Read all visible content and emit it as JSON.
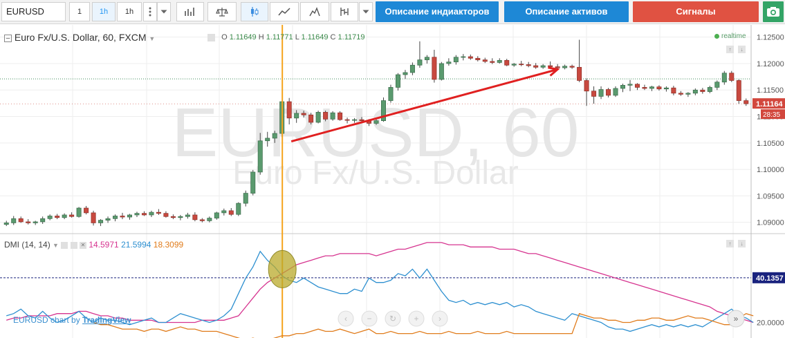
{
  "toolbar": {
    "symbol": "EURUSD",
    "intervals": [
      "1",
      "1h",
      "1h"
    ],
    "buttons": {
      "indicators": "Описание индиакторов",
      "assets": "Описание активов",
      "signals": "Сигналы"
    },
    "colors": {
      "blue": "#1e88d6",
      "red": "#e05242",
      "green": "#33a466"
    }
  },
  "chart_data": [
    {
      "type": "candlestick",
      "title": "Euro Fx/U.S. Dollar, 60, FXCM",
      "watermark_symbol": "EURUSD, 60",
      "watermark_name": "Euro Fx/U.S. Dollar",
      "ohlc_legend": {
        "o_label": "O",
        "o": "1.11649",
        "h_label": "H",
        "h": "1.11771",
        "l_label": "L",
        "l": "1.11649",
        "c_label": "C",
        "c": "1.11719"
      },
      "realtime_label": "realtime",
      "ylim": [
        1.088,
        1.126
      ],
      "y_ticks": [
        "1.12500",
        "1.12000",
        "1.11500",
        "1.11000",
        "1.10500",
        "1.10000",
        "1.09500",
        "1.09000"
      ],
      "last_price_label": "1.11164",
      "countdown_label": "28:35",
      "guide_line_price": 1.1171,
      "candles": [
        {
          "o": 1.0896,
          "h": 1.0903,
          "l": 1.0893,
          "c": 1.0899
        },
        {
          "o": 1.0899,
          "h": 1.0912,
          "l": 1.0895,
          "c": 1.0907
        },
        {
          "o": 1.0907,
          "h": 1.0911,
          "l": 1.0899,
          "c": 1.0901
        },
        {
          "o": 1.0901,
          "h": 1.0906,
          "l": 1.0896,
          "c": 1.0899
        },
        {
          "o": 1.0899,
          "h": 1.0903,
          "l": 1.0895,
          "c": 1.0901
        },
        {
          "o": 1.0901,
          "h": 1.0911,
          "l": 1.0897,
          "c": 1.0907
        },
        {
          "o": 1.0907,
          "h": 1.0915,
          "l": 1.0904,
          "c": 1.0912
        },
        {
          "o": 1.0912,
          "h": 1.0916,
          "l": 1.0906,
          "c": 1.0909
        },
        {
          "o": 1.0909,
          "h": 1.0917,
          "l": 1.0906,
          "c": 1.0914
        },
        {
          "o": 1.0914,
          "h": 1.0919,
          "l": 1.0909,
          "c": 1.0911
        },
        {
          "o": 1.0911,
          "h": 1.0929,
          "l": 1.0909,
          "c": 1.0927
        },
        {
          "o": 1.0927,
          "h": 1.0931,
          "l": 1.0915,
          "c": 1.0918
        },
        {
          "o": 1.0918,
          "h": 1.0922,
          "l": 1.0894,
          "c": 1.0899
        },
        {
          "o": 1.0899,
          "h": 1.0906,
          "l": 1.0893,
          "c": 1.0904
        },
        {
          "o": 1.0904,
          "h": 1.0911,
          "l": 1.0899,
          "c": 1.0907
        },
        {
          "o": 1.0907,
          "h": 1.0915,
          "l": 1.0902,
          "c": 1.0912
        },
        {
          "o": 1.0912,
          "h": 1.0918,
          "l": 1.0906,
          "c": 1.091
        },
        {
          "o": 1.091,
          "h": 1.0916,
          "l": 1.0905,
          "c": 1.0914
        },
        {
          "o": 1.0914,
          "h": 1.092,
          "l": 1.091,
          "c": 1.0917
        },
        {
          "o": 1.0917,
          "h": 1.0921,
          "l": 1.0912,
          "c": 1.0914
        },
        {
          "o": 1.0914,
          "h": 1.0922,
          "l": 1.091,
          "c": 1.0919
        },
        {
          "o": 1.0919,
          "h": 1.0925,
          "l": 1.0914,
          "c": 1.0917
        },
        {
          "o": 1.0917,
          "h": 1.0921,
          "l": 1.0909,
          "c": 1.0911
        },
        {
          "o": 1.0911,
          "h": 1.0915,
          "l": 1.0906,
          "c": 1.0909
        },
        {
          "o": 1.0909,
          "h": 1.0914,
          "l": 1.0904,
          "c": 1.0911
        },
        {
          "o": 1.0911,
          "h": 1.0918,
          "l": 1.0907,
          "c": 1.0914
        },
        {
          "o": 1.0914,
          "h": 1.0919,
          "l": 1.0902,
          "c": 1.0905
        },
        {
          "o": 1.0905,
          "h": 1.0908,
          "l": 1.09,
          "c": 1.0903
        },
        {
          "o": 1.0903,
          "h": 1.0911,
          "l": 1.09,
          "c": 1.0908
        },
        {
          "o": 1.0908,
          "h": 1.092,
          "l": 1.0905,
          "c": 1.0918
        },
        {
          "o": 1.0918,
          "h": 1.0926,
          "l": 1.0913,
          "c": 1.0922
        },
        {
          "o": 1.0922,
          "h": 1.0927,
          "l": 1.0912,
          "c": 1.0915
        },
        {
          "o": 1.0915,
          "h": 1.0938,
          "l": 1.0912,
          "c": 1.0936
        },
        {
          "o": 1.0936,
          "h": 1.096,
          "l": 1.093,
          "c": 1.0955
        },
        {
          "o": 1.0955,
          "h": 1.0999,
          "l": 1.0951,
          "c": 1.0995
        },
        {
          "o": 1.0995,
          "h": 1.1069,
          "l": 1.099,
          "c": 1.1054
        },
        {
          "o": 1.1054,
          "h": 1.1071,
          "l": 1.1043,
          "c": 1.1059
        },
        {
          "o": 1.1059,
          "h": 1.1073,
          "l": 1.105,
          "c": 1.1068
        },
        {
          "o": 1.1068,
          "h": 1.1129,
          "l": 1.1061,
          "c": 1.1128
        },
        {
          "o": 1.1128,
          "h": 1.1135,
          "l": 1.1085,
          "c": 1.1097
        },
        {
          "o": 1.1097,
          "h": 1.1112,
          "l": 1.1088,
          "c": 1.1106
        },
        {
          "o": 1.1106,
          "h": 1.1111,
          "l": 1.1098,
          "c": 1.1103
        },
        {
          "o": 1.1103,
          "h": 1.1107,
          "l": 1.1085,
          "c": 1.1089
        },
        {
          "o": 1.1089,
          "h": 1.1111,
          "l": 1.1087,
          "c": 1.1108
        },
        {
          "o": 1.1108,
          "h": 1.1111,
          "l": 1.1091,
          "c": 1.1095
        },
        {
          "o": 1.1095,
          "h": 1.111,
          "l": 1.1092,
          "c": 1.1107
        },
        {
          "o": 1.1107,
          "h": 1.111,
          "l": 1.1092,
          "c": 1.1094
        },
        {
          "o": 1.1094,
          "h": 1.1098,
          "l": 1.1087,
          "c": 1.1093
        },
        {
          "o": 1.1093,
          "h": 1.1097,
          "l": 1.1088,
          "c": 1.1094
        },
        {
          "o": 1.1094,
          "h": 1.1099,
          "l": 1.1088,
          "c": 1.1092
        },
        {
          "o": 1.1092,
          "h": 1.1095,
          "l": 1.1082,
          "c": 1.1087
        },
        {
          "o": 1.1087,
          "h": 1.1097,
          "l": 1.1084,
          "c": 1.1092
        },
        {
          "o": 1.1092,
          "h": 1.1136,
          "l": 1.109,
          "c": 1.113
        },
        {
          "o": 1.113,
          "h": 1.116,
          "l": 1.1126,
          "c": 1.1155
        },
        {
          "o": 1.1155,
          "h": 1.1182,
          "l": 1.1149,
          "c": 1.1179
        },
        {
          "o": 1.1179,
          "h": 1.1188,
          "l": 1.1171,
          "c": 1.1183
        },
        {
          "o": 1.1183,
          "h": 1.1202,
          "l": 1.1178,
          "c": 1.1197
        },
        {
          "o": 1.1197,
          "h": 1.1242,
          "l": 1.1192,
          "c": 1.1207
        },
        {
          "o": 1.1207,
          "h": 1.1216,
          "l": 1.12,
          "c": 1.1212
        },
        {
          "o": 1.1212,
          "h": 1.1226,
          "l": 1.1164,
          "c": 1.117
        },
        {
          "o": 1.117,
          "h": 1.1203,
          "l": 1.1168,
          "c": 1.12
        },
        {
          "o": 1.12,
          "h": 1.121,
          "l": 1.1196,
          "c": 1.1203
        },
        {
          "o": 1.1203,
          "h": 1.1216,
          "l": 1.1198,
          "c": 1.1212
        },
        {
          "o": 1.1212,
          "h": 1.1218,
          "l": 1.1206,
          "c": 1.1213
        },
        {
          "o": 1.1213,
          "h": 1.1217,
          "l": 1.1207,
          "c": 1.121
        },
        {
          "o": 1.121,
          "h": 1.1214,
          "l": 1.1204,
          "c": 1.1207
        },
        {
          "o": 1.1207,
          "h": 1.1211,
          "l": 1.1201,
          "c": 1.1204
        },
        {
          "o": 1.1204,
          "h": 1.121,
          "l": 1.1199,
          "c": 1.1202
        },
        {
          "o": 1.1202,
          "h": 1.121,
          "l": 1.12,
          "c": 1.1206
        },
        {
          "o": 1.1206,
          "h": 1.1209,
          "l": 1.1195,
          "c": 1.1197
        },
        {
          "o": 1.1197,
          "h": 1.1201,
          "l": 1.1194,
          "c": 1.1199
        },
        {
          "o": 1.1199,
          "h": 1.1205,
          "l": 1.1195,
          "c": 1.1198
        },
        {
          "o": 1.1198,
          "h": 1.1203,
          "l": 1.1193,
          "c": 1.1196
        },
        {
          "o": 1.1196,
          "h": 1.1201,
          "l": 1.119,
          "c": 1.1193
        },
        {
          "o": 1.1193,
          "h": 1.1199,
          "l": 1.119,
          "c": 1.1196
        },
        {
          "o": 1.1196,
          "h": 1.1204,
          "l": 1.1191,
          "c": 1.1194
        },
        {
          "o": 1.1194,
          "h": 1.1199,
          "l": 1.1189,
          "c": 1.1192
        },
        {
          "o": 1.1192,
          "h": 1.1198,
          "l": 1.1189,
          "c": 1.1195
        },
        {
          "o": 1.1195,
          "h": 1.1198,
          "l": 1.119,
          "c": 1.1193
        },
        {
          "o": 1.1193,
          "h": 1.1245,
          "l": 1.1165,
          "c": 1.1168
        },
        {
          "o": 1.1168,
          "h": 1.1172,
          "l": 1.112,
          "c": 1.1148
        },
        {
          "o": 1.1148,
          "h": 1.1157,
          "l": 1.1124,
          "c": 1.1138
        },
        {
          "o": 1.1138,
          "h": 1.1157,
          "l": 1.1133,
          "c": 1.1151
        },
        {
          "o": 1.1151,
          "h": 1.1154,
          "l": 1.1136,
          "c": 1.114
        },
        {
          "o": 1.114,
          "h": 1.1157,
          "l": 1.1137,
          "c": 1.1153
        },
        {
          "o": 1.1153,
          "h": 1.1162,
          "l": 1.1146,
          "c": 1.1159
        },
        {
          "o": 1.1159,
          "h": 1.1169,
          "l": 1.1148,
          "c": 1.1161
        },
        {
          "o": 1.1161,
          "h": 1.1163,
          "l": 1.115,
          "c": 1.1155
        },
        {
          "o": 1.1155,
          "h": 1.116,
          "l": 1.115,
          "c": 1.1153
        },
        {
          "o": 1.1153,
          "h": 1.1158,
          "l": 1.1148,
          "c": 1.1156
        },
        {
          "o": 1.1156,
          "h": 1.1159,
          "l": 1.1149,
          "c": 1.1152
        },
        {
          "o": 1.1152,
          "h": 1.1157,
          "l": 1.1147,
          "c": 1.1154
        },
        {
          "o": 1.1154,
          "h": 1.1158,
          "l": 1.114,
          "c": 1.1144
        },
        {
          "o": 1.1144,
          "h": 1.1148,
          "l": 1.1139,
          "c": 1.1142
        },
        {
          "o": 1.1142,
          "h": 1.1146,
          "l": 1.1137,
          "c": 1.1144
        },
        {
          "o": 1.1144,
          "h": 1.1153,
          "l": 1.114,
          "c": 1.115
        },
        {
          "o": 1.115,
          "h": 1.1154,
          "l": 1.1143,
          "c": 1.1147
        },
        {
          "o": 1.1147,
          "h": 1.1158,
          "l": 1.1144,
          "c": 1.1155
        },
        {
          "o": 1.1155,
          "h": 1.1168,
          "l": 1.115,
          "c": 1.1165
        },
        {
          "o": 1.1165,
          "h": 1.1186,
          "l": 1.116,
          "c": 1.1182
        },
        {
          "o": 1.1182,
          "h": 1.1186,
          "l": 1.1165,
          "c": 1.1168
        },
        {
          "o": 1.1168,
          "h": 1.117,
          "l": 1.1124,
          "c": 1.113
        },
        {
          "o": 1.113,
          "h": 1.1134,
          "l": 1.112,
          "c": 1.1124
        }
      ]
    },
    {
      "type": "line",
      "title": "DMI (14, 14)",
      "legend_values": [
        "14.5971",
        "21.5994",
        "18.3099"
      ],
      "ylim": [
        13,
        60
      ],
      "y_ticks": [
        "20.0000"
      ],
      "level_value": 40.1357,
      "level_label": "40.1357",
      "series": [
        {
          "values": [
            21,
            22,
            22,
            23,
            23,
            23,
            23,
            24,
            24,
            24,
            25,
            25,
            24,
            23,
            23,
            22,
            22,
            21,
            21,
            21,
            21,
            20,
            20,
            20,
            20,
            20,
            20,
            21,
            21,
            21,
            21,
            22,
            23,
            27,
            31,
            35,
            38,
            40,
            42,
            44,
            46,
            47,
            48,
            49,
            50,
            50,
            51,
            51,
            51,
            51,
            51,
            50,
            51,
            52,
            53,
            53,
            54,
            55,
            56,
            56,
            56,
            55,
            55,
            55,
            54,
            54,
            54,
            54,
            53,
            53,
            53,
            52,
            51,
            51,
            50,
            49,
            48,
            47,
            46,
            45,
            44,
            43,
            42,
            41,
            40,
            39,
            38,
            37,
            36,
            35,
            34,
            33,
            32,
            31,
            30,
            29,
            28,
            27,
            25,
            24,
            23,
            22,
            21,
            20
          ]
        },
        {
          "values": [
            23,
            24,
            26,
            23,
            22,
            25,
            22,
            20,
            21,
            23,
            25,
            22,
            20,
            22,
            21,
            21,
            20,
            19,
            20,
            21,
            22,
            20,
            20,
            22,
            24,
            23,
            22,
            21,
            20,
            21,
            23,
            26,
            33,
            40,
            45,
            52,
            48,
            45,
            41,
            39,
            38,
            40,
            38,
            36,
            35,
            34,
            33,
            33,
            35,
            34,
            40,
            38,
            38,
            39,
            42,
            41,
            44,
            40,
            44,
            39,
            34,
            30,
            29,
            30,
            28,
            29,
            28,
            29,
            28,
            29,
            27,
            28,
            27,
            25,
            24,
            23,
            22,
            21,
            24,
            23,
            22,
            21,
            20,
            18,
            17,
            17,
            16,
            17,
            18,
            19,
            18,
            19,
            18,
            19,
            18,
            19,
            18,
            20,
            22,
            24,
            26,
            23,
            22,
            20
          ]
        },
        {
          "values": [
            null,
            null,
            null,
            null,
            null,
            null,
            null,
            null,
            null,
            null,
            null,
            null,
            20,
            19,
            19,
            18,
            17,
            17,
            17,
            16,
            17,
            17,
            16,
            17,
            18,
            17,
            17,
            16,
            16,
            16,
            15,
            14,
            13,
            12,
            13,
            12,
            12,
            13,
            14,
            14,
            15,
            15,
            16,
            17,
            16,
            16,
            17,
            16,
            15,
            16,
            17,
            15,
            15,
            16,
            15,
            15,
            15,
            16,
            15,
            15,
            15,
            16,
            15,
            15,
            15,
            16,
            15,
            15,
            15,
            16,
            15,
            15,
            15,
            15,
            15,
            15,
            15,
            15,
            15,
            24,
            23,
            22,
            22,
            21,
            21,
            20,
            20,
            21,
            21,
            22,
            22,
            21,
            21,
            22,
            23,
            22,
            22,
            21,
            20,
            19,
            19,
            22,
            24,
            23
          ]
        }
      ]
    }
  ],
  "attribution": {
    "prefix": "EURUSD chart by ",
    "brand": "TradingView"
  }
}
